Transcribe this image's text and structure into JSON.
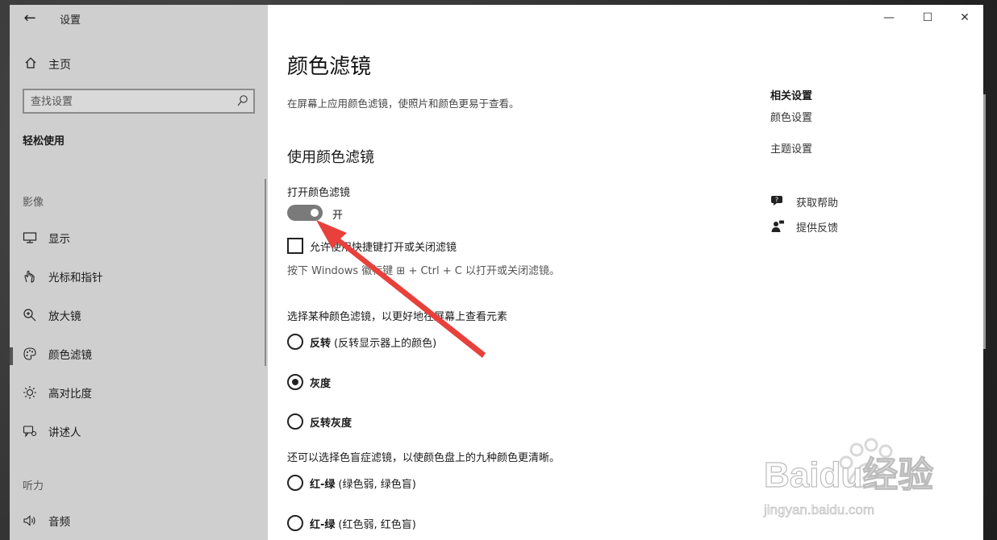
{
  "window": {
    "title": "设置",
    "controls": {
      "minimize": "—",
      "maximize": "☐",
      "close": "✕"
    }
  },
  "sidebar": {
    "home_label": "主页",
    "search_placeholder": "查找设置",
    "section": "轻松使用",
    "vision_label": "影像",
    "hearing_label": "听力",
    "items": [
      {
        "label": "显示",
        "icon": "monitor-icon"
      },
      {
        "label": "光标和指针",
        "icon": "pointer-icon"
      },
      {
        "label": "放大镜",
        "icon": "magnifier-icon"
      },
      {
        "label": "颜色滤镜",
        "icon": "palette-icon",
        "selected": true
      },
      {
        "label": "高对比度",
        "icon": "brightness-icon"
      },
      {
        "label": "讲述人",
        "icon": "narrator-icon"
      },
      {
        "label": "音频",
        "icon": "speaker-icon"
      }
    ]
  },
  "main": {
    "title": "颜色滤镜",
    "description": "在屏幕上应用颜色滤镜，使照片和颜色更易于查看。",
    "subheading": "使用颜色滤镜",
    "toggle_label": "打开颜色滤镜",
    "toggle_state": "开",
    "toggle_on": true,
    "shortcut_checkbox_label": "允许使用快捷键打开或关闭滤镜",
    "shortcut_checked": false,
    "shortcut_hint": "按下 Windows 徽标键 ⊞ + Ctrl + C 以打开或关闭滤镜。",
    "filter_heading": "选择某种颜色滤镜，以更好地在屏幕上查看元素",
    "filters": [
      {
        "name": "反转",
        "detail": "(反转显示器上的颜色)",
        "checked": false
      },
      {
        "name": "灰度",
        "detail": "",
        "checked": true
      },
      {
        "name": "反转灰度",
        "detail": "",
        "checked": false
      }
    ],
    "colorblind_heading": "还可以选择色盲症滤镜，以使颜色盘上的九种颜色更清晰。",
    "colorblind_filters": [
      {
        "name": "红-绿",
        "detail": "(绿色弱, 绿色盲)",
        "checked": false
      },
      {
        "name": "红-绿",
        "detail": "(红色弱, 红色盲)",
        "checked": false
      }
    ]
  },
  "related": {
    "heading": "相关设置",
    "links": [
      "颜色设置",
      "主题设置"
    ],
    "help": "获取帮助",
    "feedback": "提供反馈"
  },
  "watermark": {
    "brand": "Baidu经验",
    "url": "jingyan.baidu.com"
  },
  "colors": {
    "sidebar_bg": "#cfcfcf",
    "annotation_arrow": "#e8403a",
    "toggle_on": "#7a7a7a"
  }
}
